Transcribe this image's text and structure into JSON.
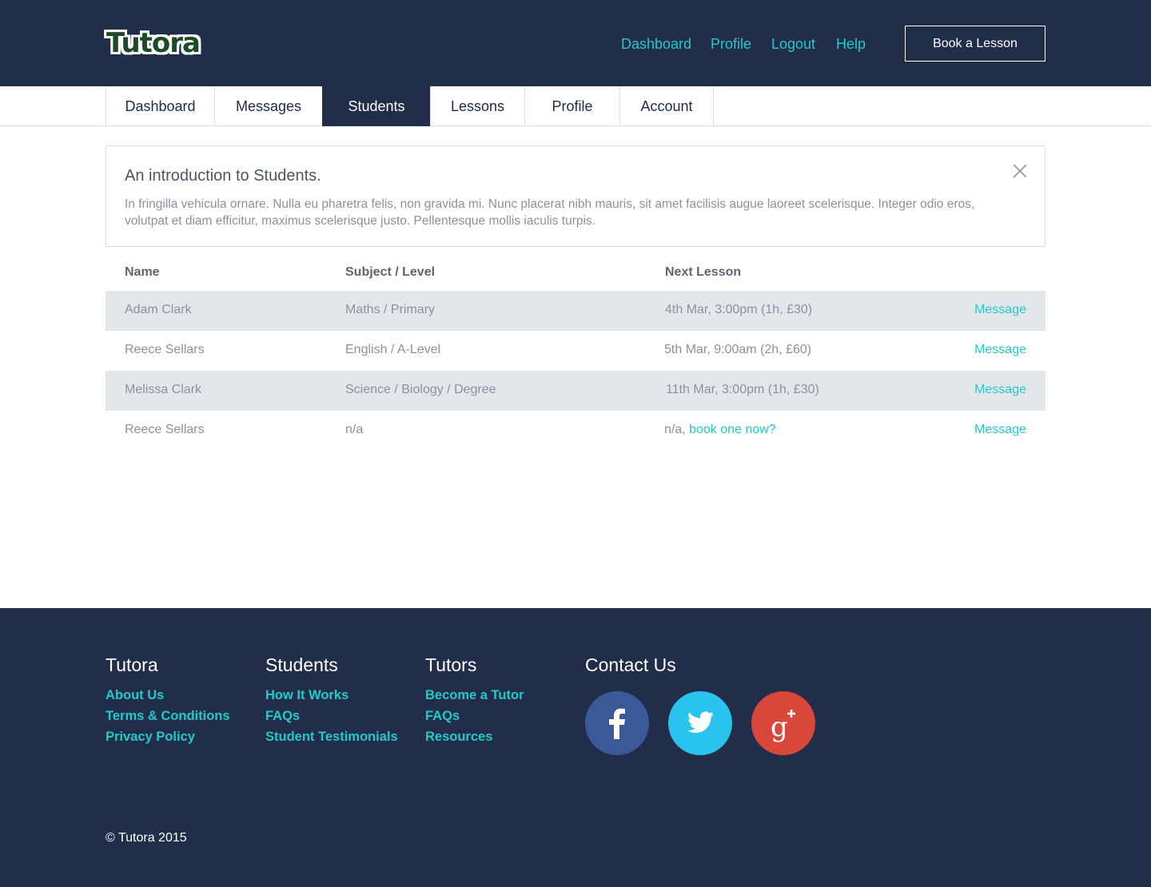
{
  "header": {
    "logo": "Tutora",
    "nav": [
      "Dashboard",
      "Profile",
      "Logout",
      "Help"
    ],
    "cta": "Book a Lesson"
  },
  "tabs": [
    {
      "label": "Dashboard",
      "active": false
    },
    {
      "label": "Messages",
      "active": false
    },
    {
      "label": "Students",
      "active": true
    },
    {
      "label": "Lessons",
      "active": false
    },
    {
      "label": "Profile",
      "active": false
    },
    {
      "label": "Account",
      "active": false
    }
  ],
  "intro": {
    "title": "An introduction to Students.",
    "body": "In fringilla vehicula ornare. Nulla eu pharetra felis, non gravida mi. Nunc placerat nibh mauris, sit amet facilisis augue laoreet scelerisque. Integer odio eros, volutpat et diam efficitur, maximus scelerisque justo. Pellentesque mollis iaculis turpis."
  },
  "table": {
    "headers": [
      "Name",
      "Subject / Level",
      "Next Lesson"
    ],
    "rows": [
      {
        "name": "Adam Clark",
        "subject": "Maths / Primary",
        "next": "4th Mar, 3:00pm (1h, £30)",
        "action": "Message"
      },
      {
        "name": "Reece Sellars",
        "subject": "English / A-Level",
        "next": "5th Mar, 9:00am (2h, £60)",
        "action": "Message"
      },
      {
        "name": "Melissa Clark",
        "subject": "Science / Biology / Degree",
        "next": "11th Mar, 3:00pm (1h, £30)",
        "action": "Message"
      },
      {
        "name": "Reece Sellars",
        "subject": "n/a",
        "next": "n/a,",
        "next_link": "book one now?",
        "action": "Message"
      }
    ]
  },
  "footer": {
    "columns": [
      {
        "heading": "Tutora",
        "links": [
          "About Us",
          "Terms & Conditions",
          "Privacy Policy"
        ]
      },
      {
        "heading": "Students",
        "links": [
          "How It Works",
          "FAQs",
          "Student Testimonials"
        ]
      },
      {
        "heading": "Tutors",
        "links": [
          "Become a Tutor",
          "FAQs",
          "Resources"
        ]
      }
    ],
    "contact_heading": "Contact Us",
    "social": [
      {
        "icon": "facebook-icon",
        "color": "#3b5998"
      },
      {
        "icon": "twitter-icon",
        "color": "#29c3f0"
      },
      {
        "icon": "google-plus-icon",
        "color": "#d9473a"
      }
    ],
    "copyright": "© Tutora 2015"
  },
  "colors": {
    "navy": "#222d4a",
    "accent": "#22c9c9",
    "row_shade": "#e3e7eb"
  }
}
